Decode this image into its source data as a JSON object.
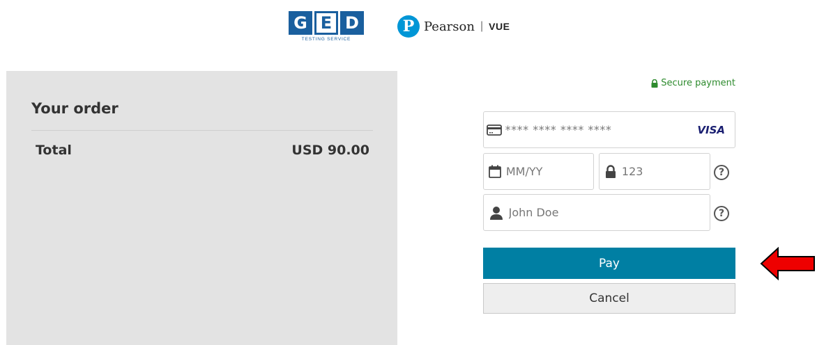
{
  "header": {
    "ged_letters": [
      "G",
      "E",
      "D"
    ],
    "ged_subtitle": "TESTING SERVICE",
    "pearson_mark": "P",
    "pearson_name": "Pearson",
    "pearson_sep": "|",
    "pearson_vue": "VUE"
  },
  "order": {
    "title": "Your order",
    "total_label": "Total",
    "total_value": "USD 90.00"
  },
  "payment": {
    "secure_label": "Secure payment",
    "card_number_placeholder": "**** **** **** ****",
    "card_brand": "VISA",
    "expiry_placeholder": "MM/YY",
    "cvc_placeholder": "123",
    "name_placeholder": "John Doe",
    "help_glyph": "?",
    "pay_label": "Pay",
    "cancel_label": "Cancel"
  },
  "colors": {
    "pay_button": "#007fa3",
    "secure_text": "#2e8b2e",
    "order_panel_bg": "#e3e3e3",
    "annotation_arrow": "#ff0000"
  },
  "icons": {
    "card": "credit-card-icon",
    "calendar": "calendar-icon",
    "lock": "lock-icon",
    "user": "user-icon",
    "help": "help-circle-icon",
    "arrow": "left-arrow-icon"
  }
}
